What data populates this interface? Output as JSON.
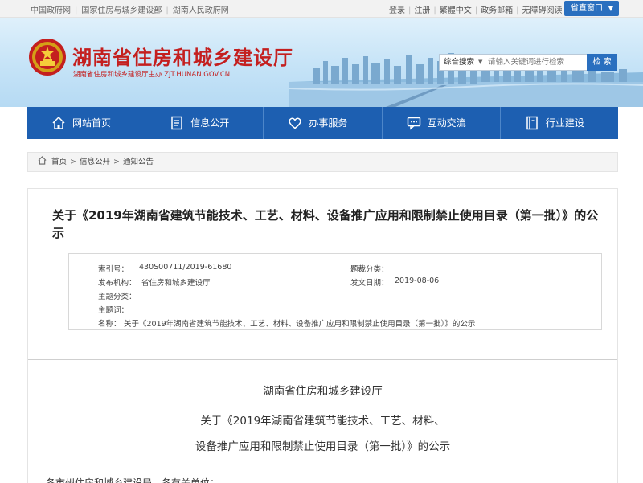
{
  "topbar": {
    "links": [
      "中国政府网",
      "国家住房与城乡建设部",
      "湖南人民政府网"
    ],
    "user_links": [
      "登录",
      "注册",
      "繁體中文",
      "政务邮箱",
      "无障碍阅读"
    ],
    "window_button": "省直窗口"
  },
  "header": {
    "site_title": "湖南省住房和城乡建设厅",
    "site_subtitle": "湖南省住房和城乡建设厅主办  ZJT.HUNAN.GOV.CN",
    "search": {
      "scope": "综合搜索",
      "placeholder": "请输入关键词进行检索",
      "button_label": "检 索"
    }
  },
  "nav": {
    "items": [
      {
        "label": "网站首页",
        "icon": "home-icon"
      },
      {
        "label": "信息公开",
        "icon": "document-icon"
      },
      {
        "label": "办事服务",
        "icon": "heart-service-icon"
      },
      {
        "label": "互动交流",
        "icon": "chat-icon"
      },
      {
        "label": "行业建设",
        "icon": "book-icon"
      }
    ]
  },
  "breadcrumb": {
    "items": [
      "首页",
      "信息公开",
      "通知公告"
    ]
  },
  "article": {
    "title": "关于《2019年湖南省建筑节能技术、工艺、材料、设备推广应用和限制禁止使用目录（第一批）》的公示",
    "meta": {
      "index_label": "索引号：",
      "index_value": "430S00711/2019-61680",
      "category_label": "题裁分类：",
      "category_value": "",
      "publisher_label": "发布机构：",
      "publisher_value": "省住房和城乡建设厅",
      "date_label": "发文日期：",
      "date_value": "2019-08-06",
      "topic_label": "主题分类：",
      "topic_value": "",
      "keyword_label": "主题词：",
      "keyword_value": "",
      "name_label": "名称：",
      "name_value": "关于《2019年湖南省建筑节能技术、工艺、材料、设备推广应用和限制禁止使用目录（第一批）》的公示"
    },
    "body": {
      "org": "湖南省住房和城乡建设厅",
      "line1": "关于《2019年湖南省建筑节能技术、工艺、材料、",
      "line2": "设备推广应用和限制禁止使用目录（第一批）》的公示",
      "greeting": "各市州住房和城乡建设局、各有关单位："
    }
  },
  "colors": {
    "brand_red": "#c41f1f",
    "nav_blue": "#1d5fb1",
    "accent_blue": "#2a6fbf"
  }
}
